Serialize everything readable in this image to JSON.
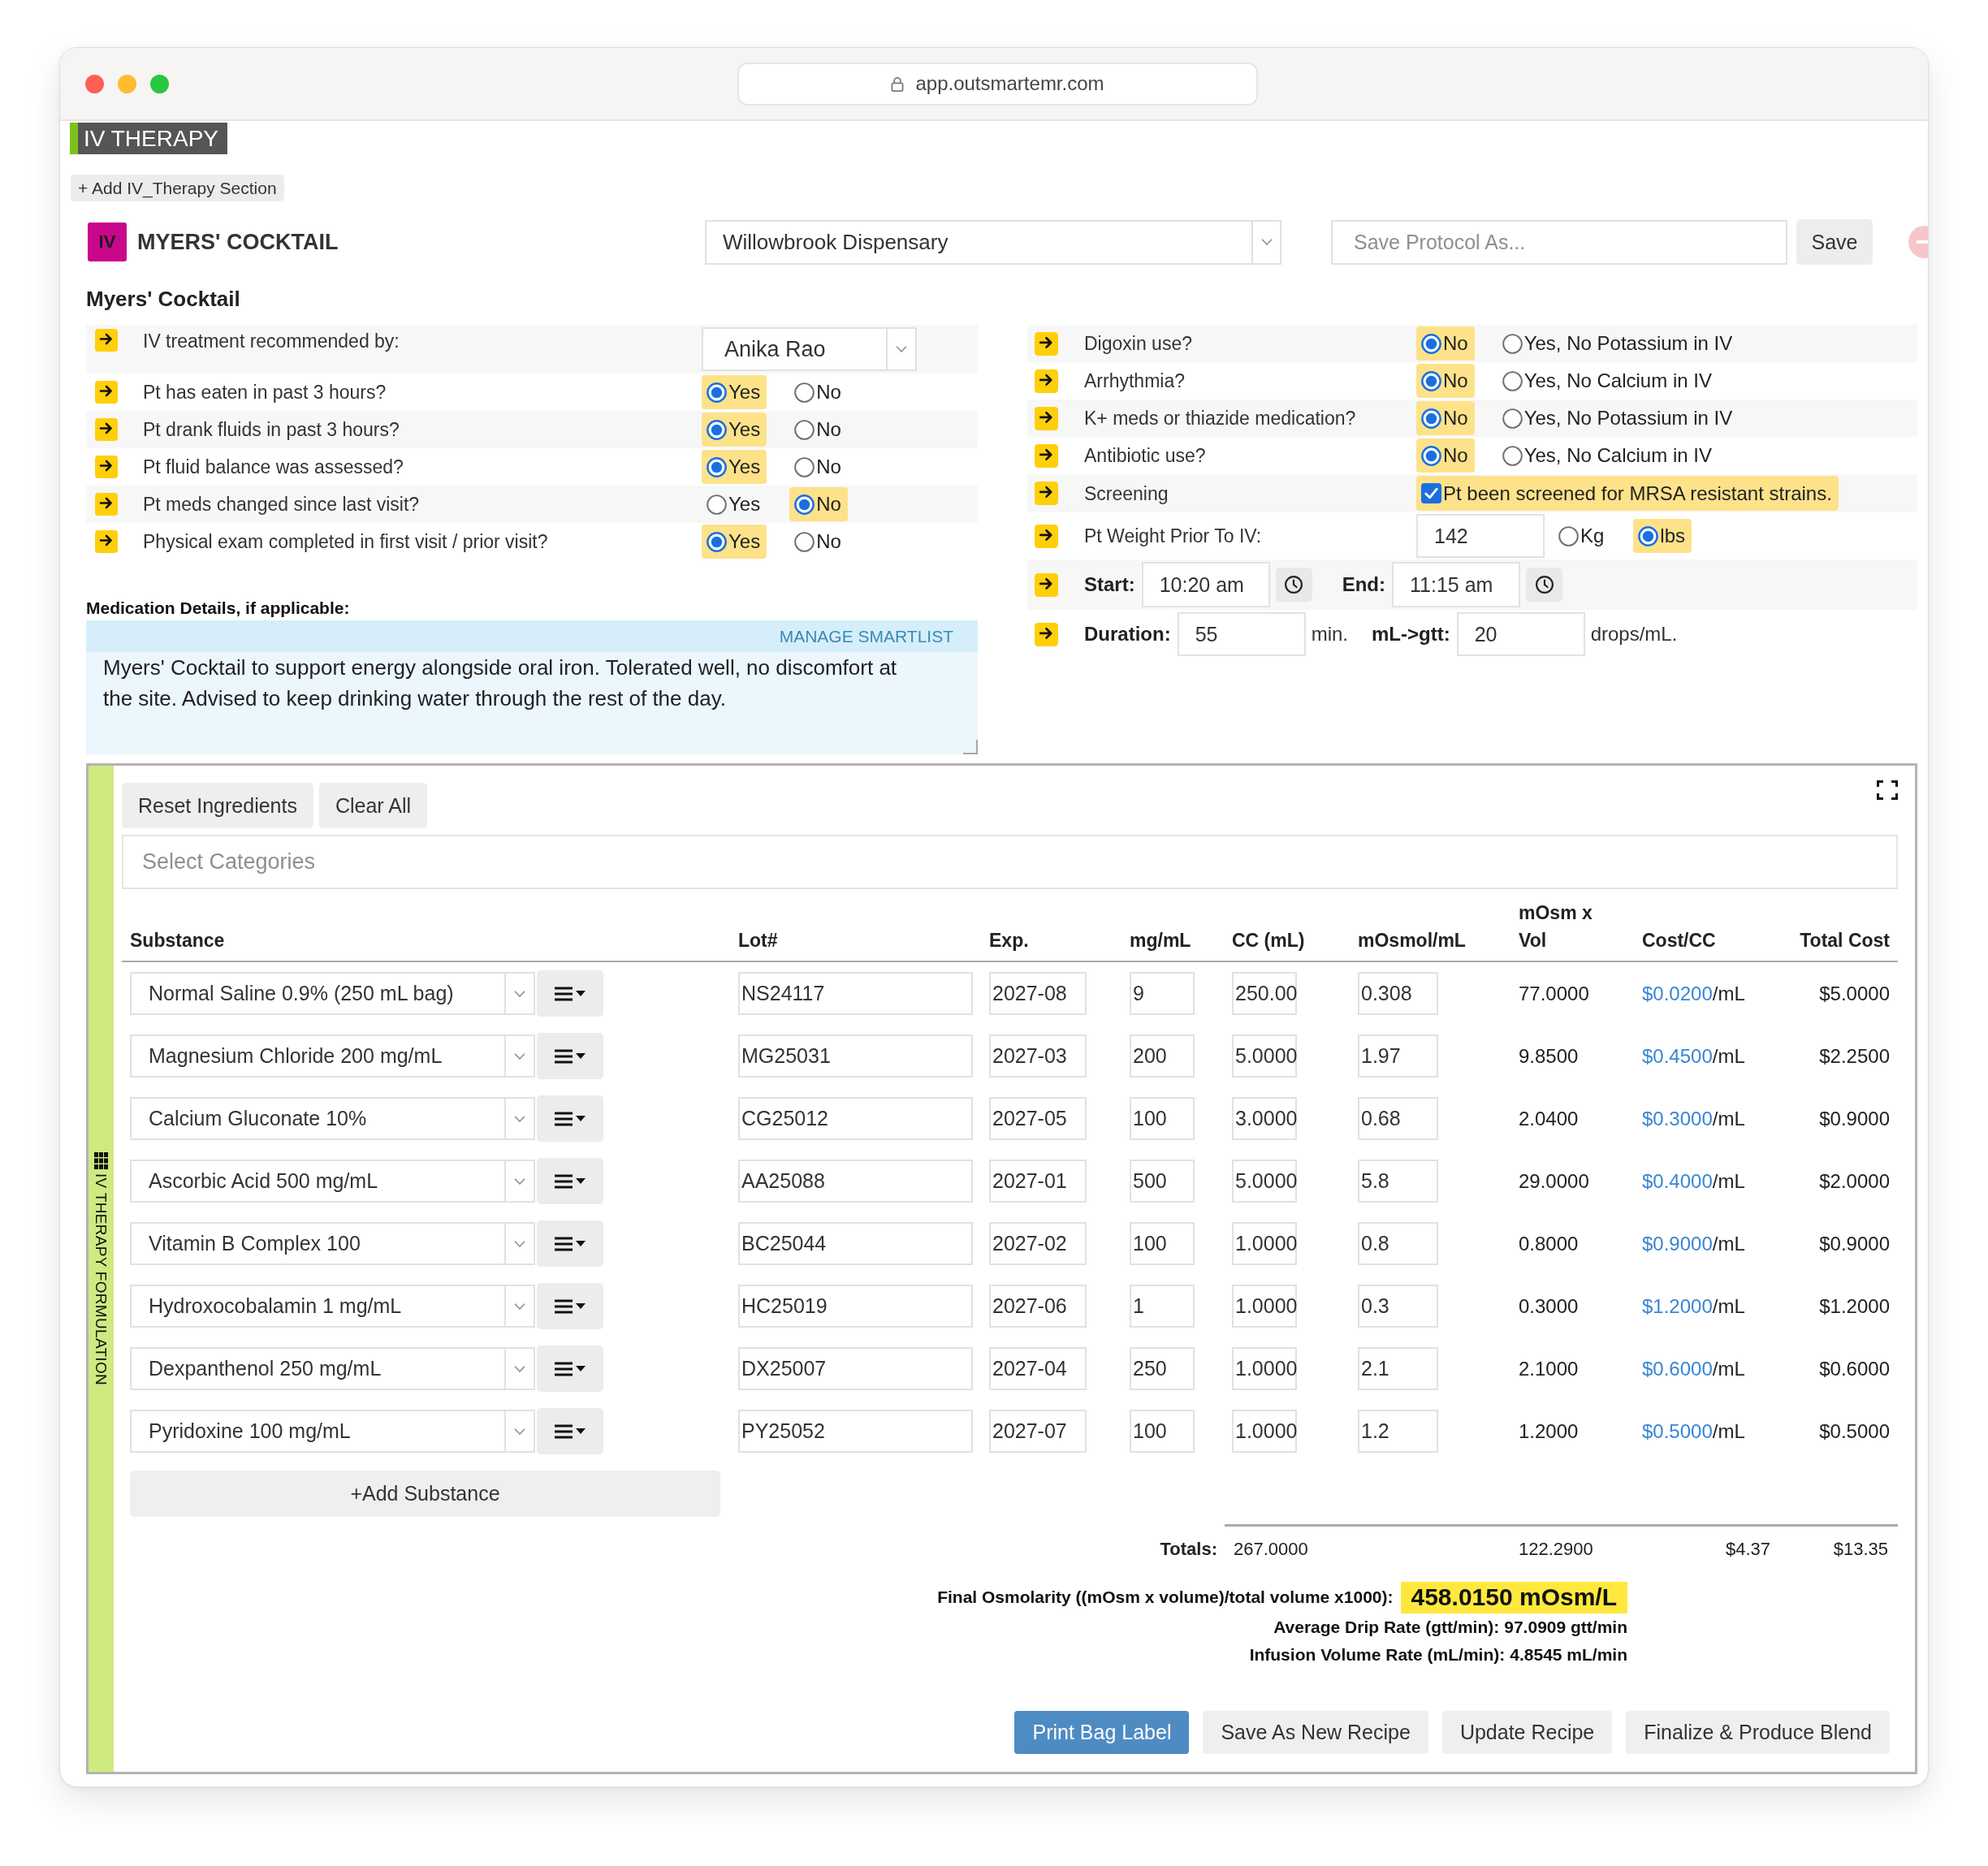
{
  "browser": {
    "url": "app.outsmartemr.com"
  },
  "section": {
    "title": "IV THERAPY",
    "add_button": "+ Add IV_Therapy Section"
  },
  "protocol": {
    "badge": "IV",
    "title": "MYERS' COCKTAIL",
    "dispensary": "Willowbrook Dispensary",
    "name_field": {
      "placeholder": "Save Protocol As..."
    },
    "save_button": "Save"
  },
  "form_title": "Myers' Cocktail",
  "left_questions": [
    {
      "kind": "select",
      "label": "IV treatment recommended by:",
      "value": "Anika Rao"
    },
    {
      "kind": "radio",
      "label": "Pt has eaten in past 3 hours?",
      "options": [
        {
          "label": "Yes",
          "selected": true
        },
        {
          "label": "No",
          "selected": false
        }
      ]
    },
    {
      "kind": "radio",
      "label": "Pt drank fluids in past 3 hours?",
      "options": [
        {
          "label": "Yes",
          "selected": true
        },
        {
          "label": "No",
          "selected": false
        }
      ]
    },
    {
      "kind": "radio",
      "label": "Pt fluid balance was assessed?",
      "options": [
        {
          "label": "Yes",
          "selected": true
        },
        {
          "label": "No",
          "selected": false
        }
      ]
    },
    {
      "kind": "radio",
      "label": "Pt meds changed since last visit?",
      "options": [
        {
          "label": "Yes",
          "selected": false
        },
        {
          "label": "No",
          "selected": true
        }
      ]
    },
    {
      "kind": "radio",
      "label": "Physical exam completed in first visit / prior visit?",
      "options": [
        {
          "label": "Yes",
          "selected": true
        },
        {
          "label": "No",
          "selected": false
        }
      ]
    }
  ],
  "medication_details": {
    "label": "Medication Details, if applicable:",
    "action": "MANAGE SMARTLIST",
    "text": "Myers' Cocktail to support energy alongside oral iron. Tolerated well, no discomfort at the site. Advised to keep drinking water through the rest of the day."
  },
  "right_questions": [
    {
      "kind": "radio",
      "label": "Digoxin use?",
      "options": [
        {
          "label": "No",
          "selected": true
        },
        {
          "label": "Yes, No Potassium in IV",
          "selected": false
        }
      ]
    },
    {
      "kind": "radio",
      "label": "Arrhythmia?",
      "options": [
        {
          "label": "No",
          "selected": true
        },
        {
          "label": "Yes, No Calcium in IV",
          "selected": false
        }
      ]
    },
    {
      "kind": "radio",
      "label": "K+ meds or thiazide medication?",
      "options": [
        {
          "label": "No",
          "selected": true
        },
        {
          "label": "Yes, No Potassium in IV",
          "selected": false
        }
      ]
    },
    {
      "kind": "radio",
      "label": "Antibiotic use?",
      "options": [
        {
          "label": "No",
          "selected": true
        },
        {
          "label": "Yes, No Calcium in IV",
          "selected": false
        }
      ]
    },
    {
      "kind": "checkbox",
      "label": "Screening",
      "option": {
        "label": "Pt been screened for MRSA resistant strains.",
        "checked": true
      }
    },
    {
      "kind": "weight",
      "label": "Pt Weight Prior To IV:",
      "value": "142",
      "options": [
        {
          "label": "Kg",
          "selected": false
        },
        {
          "label": "lbs",
          "selected": true
        }
      ]
    },
    {
      "kind": "time_range",
      "fields": [
        {
          "label": "Start:",
          "value": "10:20 am"
        },
        {
          "label": "End:",
          "value": "11:15 am"
        }
      ]
    },
    {
      "kind": "rates",
      "fields": [
        {
          "label": "Duration:",
          "value": "55",
          "unit": "min."
        },
        {
          "label": "mL->gtt:",
          "value": "20",
          "unit": "drops/mL."
        }
      ]
    }
  ],
  "formulation": {
    "side_label": "IV THERAPY FORMULATION",
    "toolbar": [
      "Reset Ingredients",
      "Clear All"
    ],
    "categories": {
      "placeholder": "Select Categories"
    },
    "columns": [
      "Substance",
      "Lot#",
      "Exp.",
      "mg/mL",
      "CC (mL)",
      "mOsmol/mL",
      "mOsm x Vol",
      "Cost/CC",
      "Total Cost"
    ],
    "rows": [
      {
        "substance": "Normal Saline 0.9% (250 mL bag)",
        "lot": "NS24117",
        "exp": "2027-08",
        "mg_ml": "9",
        "cc": "250.00",
        "mosmol_ml": "0.308",
        "mosm_vol": "77.0000",
        "cost_cc": "$0.0200",
        "cost_unit": "/mL",
        "total": "$5.0000"
      },
      {
        "substance": "Magnesium Chloride 200 mg/mL",
        "lot": "MG25031",
        "exp": "2027-03",
        "mg_ml": "200",
        "cc": "5.0000",
        "mosmol_ml": "1.97",
        "mosm_vol": "9.8500",
        "cost_cc": "$0.4500",
        "cost_unit": "/mL",
        "total": "$2.2500"
      },
      {
        "substance": "Calcium Gluconate 10%",
        "lot": "CG25012",
        "exp": "2027-05",
        "mg_ml": "100",
        "cc": "3.0000",
        "mosmol_ml": "0.68",
        "mosm_vol": "2.0400",
        "cost_cc": "$0.3000",
        "cost_unit": "/mL",
        "total": "$0.9000"
      },
      {
        "substance": "Ascorbic Acid 500 mg/mL",
        "lot": "AA25088",
        "exp": "2027-01",
        "mg_ml": "500",
        "cc": "5.0000",
        "mosmol_ml": "5.8",
        "mosm_vol": "29.0000",
        "cost_cc": "$0.4000",
        "cost_unit": "/mL",
        "total": "$2.0000"
      },
      {
        "substance": "Vitamin B Complex 100",
        "lot": "BC25044",
        "exp": "2027-02",
        "mg_ml": "100",
        "cc": "1.0000",
        "mosmol_ml": "0.8",
        "mosm_vol": "0.8000",
        "cost_cc": "$0.9000",
        "cost_unit": "/mL",
        "total": "$0.9000"
      },
      {
        "substance": "Hydroxocobalamin 1 mg/mL",
        "lot": "HC25019",
        "exp": "2027-06",
        "mg_ml": "1",
        "cc": "1.0000",
        "mosmol_ml": "0.3",
        "mosm_vol": "0.3000",
        "cost_cc": "$1.2000",
        "cost_unit": "/mL",
        "total": "$1.2000"
      },
      {
        "substance": "Dexpanthenol 250 mg/mL",
        "lot": "DX25007",
        "exp": "2027-04",
        "mg_ml": "250",
        "cc": "1.0000",
        "mosmol_ml": "2.1",
        "mosm_vol": "2.1000",
        "cost_cc": "$0.6000",
        "cost_unit": "/mL",
        "total": "$0.6000"
      },
      {
        "substance": "Pyridoxine 100 mg/mL",
        "lot": "PY25052",
        "exp": "2027-07",
        "mg_ml": "100",
        "cc": "1.0000",
        "mosmol_ml": "1.2",
        "mosm_vol": "1.2000",
        "cost_cc": "$0.5000",
        "cost_unit": "/mL",
        "total": "$0.5000"
      }
    ],
    "add_button": "+Add Substance",
    "totals": {
      "label": "Totals:",
      "cc": "267.0000",
      "mosm_vol": "122.2900",
      "cost_cc": "$4.37",
      "total": "$13.35"
    },
    "summary": [
      {
        "label": "Final Osmolarity ((mOsm x volume)/total volume x1000):",
        "value": "458.0150 mOsm/L",
        "highlight": true
      },
      {
        "label": "Average Drip Rate (gtt/min):",
        "value": "97.0909 gtt/min",
        "highlight": false
      },
      {
        "label": "Infusion Volume Rate (mL/min):",
        "value": "4.8545 mL/min",
        "highlight": false
      }
    ],
    "actions": [
      {
        "label": "Print Bag Label",
        "primary": true
      },
      {
        "label": "Save As New Recipe",
        "primary": false
      },
      {
        "label": "Update Recipe",
        "primary": false
      },
      {
        "label": "Finalize & Produce Blend",
        "primary": false
      }
    ]
  }
}
